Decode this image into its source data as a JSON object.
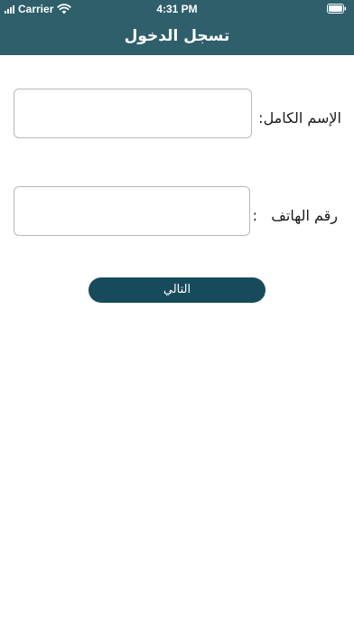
{
  "status_bar": {
    "carrier": "Carrier",
    "time": "4:31 PM",
    "signal_icon": "cellular-signal-icon",
    "wifi_icon": "wifi-icon",
    "battery_icon": "battery-icon"
  },
  "header": {
    "title": "تسجل الدخول",
    "background_color": "#2e5f6b"
  },
  "form": {
    "fullname_label": "الإسم الكامل:",
    "fullname_value": "",
    "phone_label": "رقم الهاتف   :",
    "phone_value": ""
  },
  "actions": {
    "next_label": "التالي",
    "button_color": "#174b5c"
  }
}
